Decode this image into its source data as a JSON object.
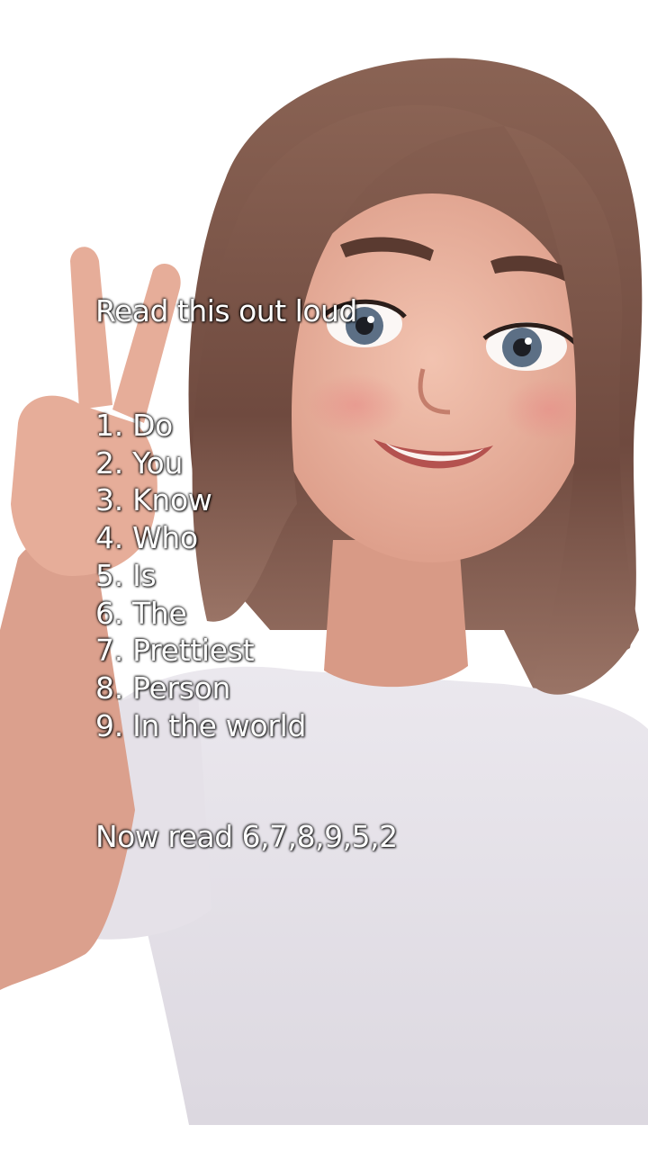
{
  "overlay": {
    "heading": "Read this out loud",
    "list_items": [
      "1. Do",
      "2. You",
      "3. Know",
      "4. Who",
      "5. Is",
      "6. The",
      "7. Prettiest",
      "8. Person",
      "9. In the world"
    ],
    "instruction": "Now read 6,7,8,9,5,2"
  },
  "colors": {
    "background": "#ffffff",
    "text": "#ffffff",
    "shirt": "#e7e3e9",
    "hair": "#7b5448",
    "skin": "#e9b29f"
  }
}
